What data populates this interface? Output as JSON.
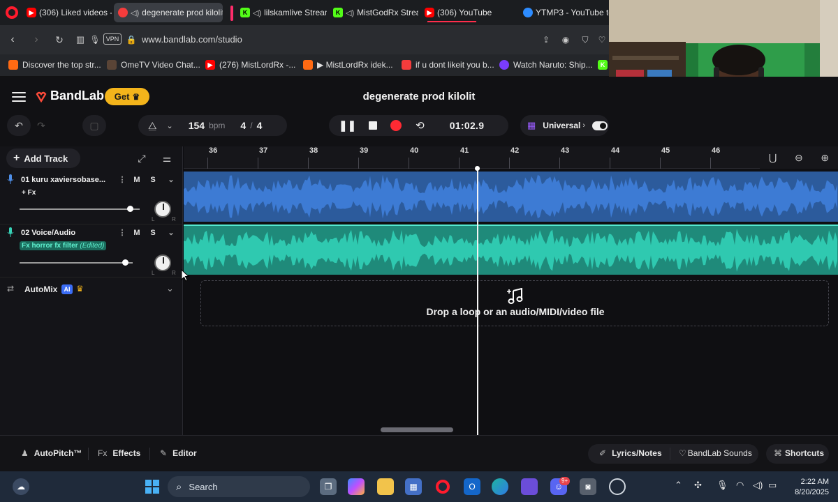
{
  "browser": {
    "tabs": [
      {
        "label": "(306) Liked videos - Y",
        "favicon": "youtube-icon"
      },
      {
        "label": "degenerate prod kilolit",
        "favicon": "bandlab-icon",
        "active": true
      },
      {
        "label": "lilskamlive Stream",
        "favicon": "kick-icon"
      },
      {
        "label": "MistGodRx Stream",
        "favicon": "kick-icon"
      },
      {
        "label": "(306) YouTube",
        "favicon": "youtube-icon"
      },
      {
        "label": "YTMP3 - YouTube to",
        "favicon": "ytmp3-icon"
      }
    ],
    "vpn_label": "VPN",
    "url": "www.bandlab.com/studio",
    "bookmarks": [
      {
        "label": "Discover the top str...",
        "favicon": "orange-icon"
      },
      {
        "label": "OmeTV Video Chat...",
        "favicon": "camera-icon"
      },
      {
        "label": "(276) MistLordRx -...",
        "favicon": "youtube-icon"
      },
      {
        "label": "▶ MistLordRx idek...",
        "favicon": "soundcloud-icon"
      },
      {
        "label": "if u dont likeit you b...",
        "favicon": "bandlab-icon"
      },
      {
        "label": "Watch Naruto: Ship...",
        "favicon": "purple-icon"
      }
    ]
  },
  "app": {
    "brand": "BandLab",
    "get_label": "Get",
    "project_title": "degenerate prod kilolit",
    "tempo": "154",
    "tempo_unit": "bpm",
    "time_sig_num": "4",
    "time_sig_sep": "/",
    "time_sig_den": "4",
    "time": "01:02.9",
    "key_label": "Universal",
    "add_track_label": "Add Track",
    "tracks": [
      {
        "name": "01  kuru xaviersobase...",
        "m": "M",
        "s": "S",
        "fx_label": "+ Fx",
        "volume": 0.92,
        "color": "#3d7bd4"
      },
      {
        "name": "02  Voice/Audio",
        "m": "M",
        "s": "S",
        "fx_label": "Fx horror fx filter",
        "fx_edited": "(Edited)",
        "volume": 0.88,
        "color": "#2fc9b0"
      }
    ],
    "automix_label": "AutoMix",
    "ai_badge": "AI",
    "ruler_bars": [
      "36",
      "37",
      "38",
      "39",
      "40",
      "41",
      "42",
      "43",
      "44",
      "45",
      "46"
    ],
    "drop_text": "Drop a loop or an audio/MIDI/video file",
    "bottom_bar": {
      "autopitch": "AutoPitch™",
      "effects_prefix": "Fx",
      "effects": "Effects",
      "editor": "Editor",
      "lyrics": "Lyrics/Notes",
      "sounds": "BandLab Sounds",
      "shortcuts": "Shortcuts"
    }
  },
  "taskbar": {
    "search_label": "Search",
    "discord_badge": "9+",
    "time": "2:22 AM",
    "date": "8/20/2025"
  }
}
